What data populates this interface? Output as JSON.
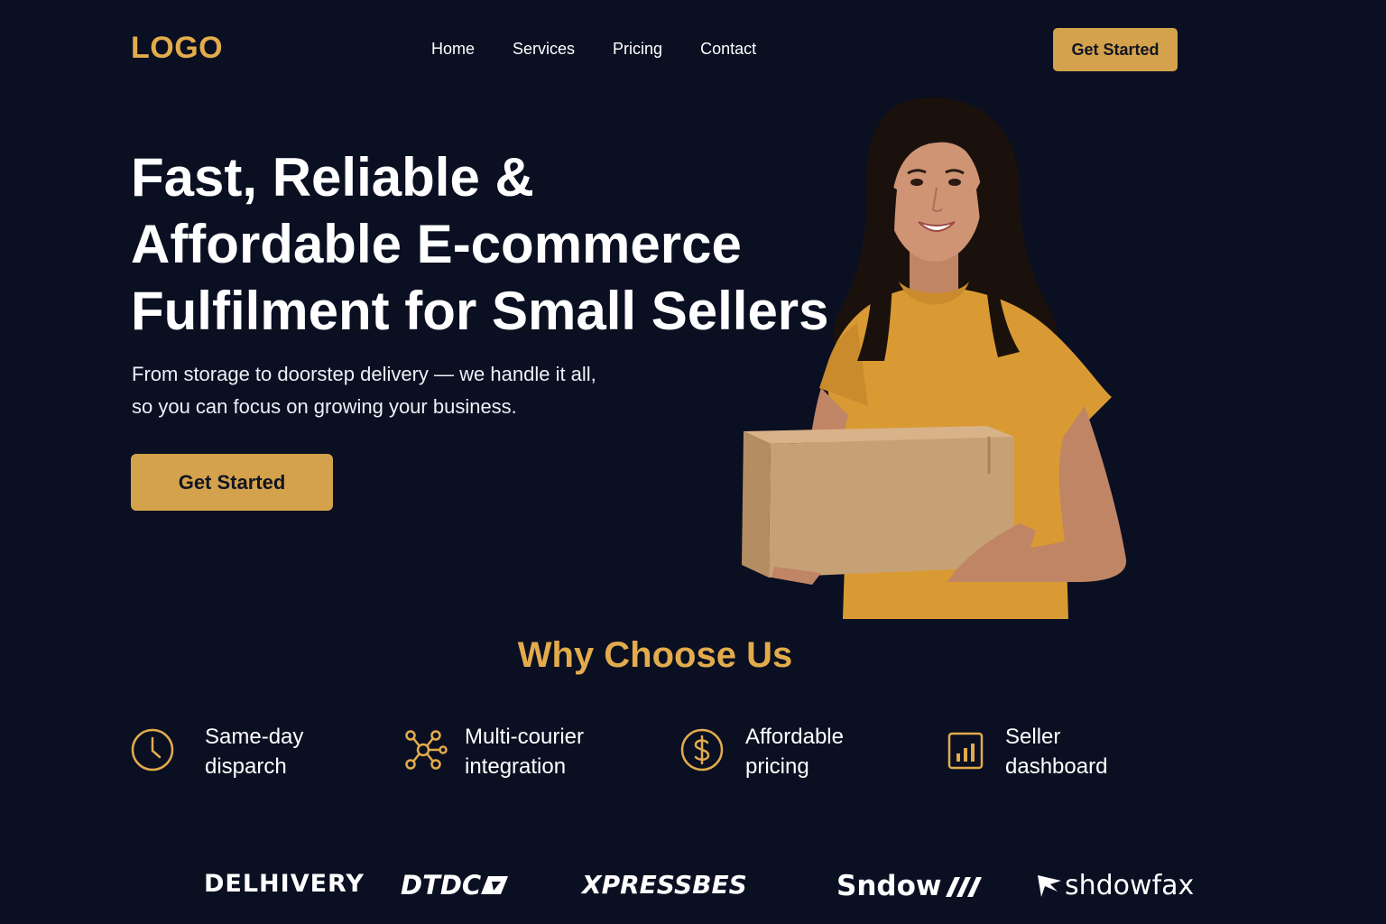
{
  "header": {
    "logo": "LOGO",
    "nav": [
      "Home",
      "Services",
      "Pricing",
      "Contact"
    ],
    "cta_label": "Get Started"
  },
  "hero": {
    "title_lines": [
      "Fast, Reliable &",
      "Affordable E-commerce",
      "Fulfilment for Small Sellers"
    ],
    "subtitle_lines": [
      "From storage to doorstep delivery — we handle it all,",
      "so you can focus on growing your business."
    ],
    "cta_label": "Get Started",
    "image": "woman-holding-cardboard-box"
  },
  "why": {
    "title": "Why Choose Us",
    "features": [
      {
        "icon": "clock-icon",
        "lines": [
          "Same-day",
          "disparch"
        ]
      },
      {
        "icon": "network-icon",
        "lines": [
          "Multi-courier",
          "integration"
        ]
      },
      {
        "icon": "dollar-icon",
        "lines": [
          "Affordable",
          "pricing"
        ]
      },
      {
        "icon": "bar-chart-icon",
        "lines": [
          "Seller",
          "dashboard"
        ]
      }
    ]
  },
  "partners": [
    "DELHIVERY",
    "DTDC",
    "XPRESSBES",
    "Sndow",
    "shdowfax"
  ],
  "colors": {
    "background": "#0a0f22",
    "accent": "#d4a24c",
    "accent_text": "#e2ab4c",
    "text": "#ffffff"
  }
}
